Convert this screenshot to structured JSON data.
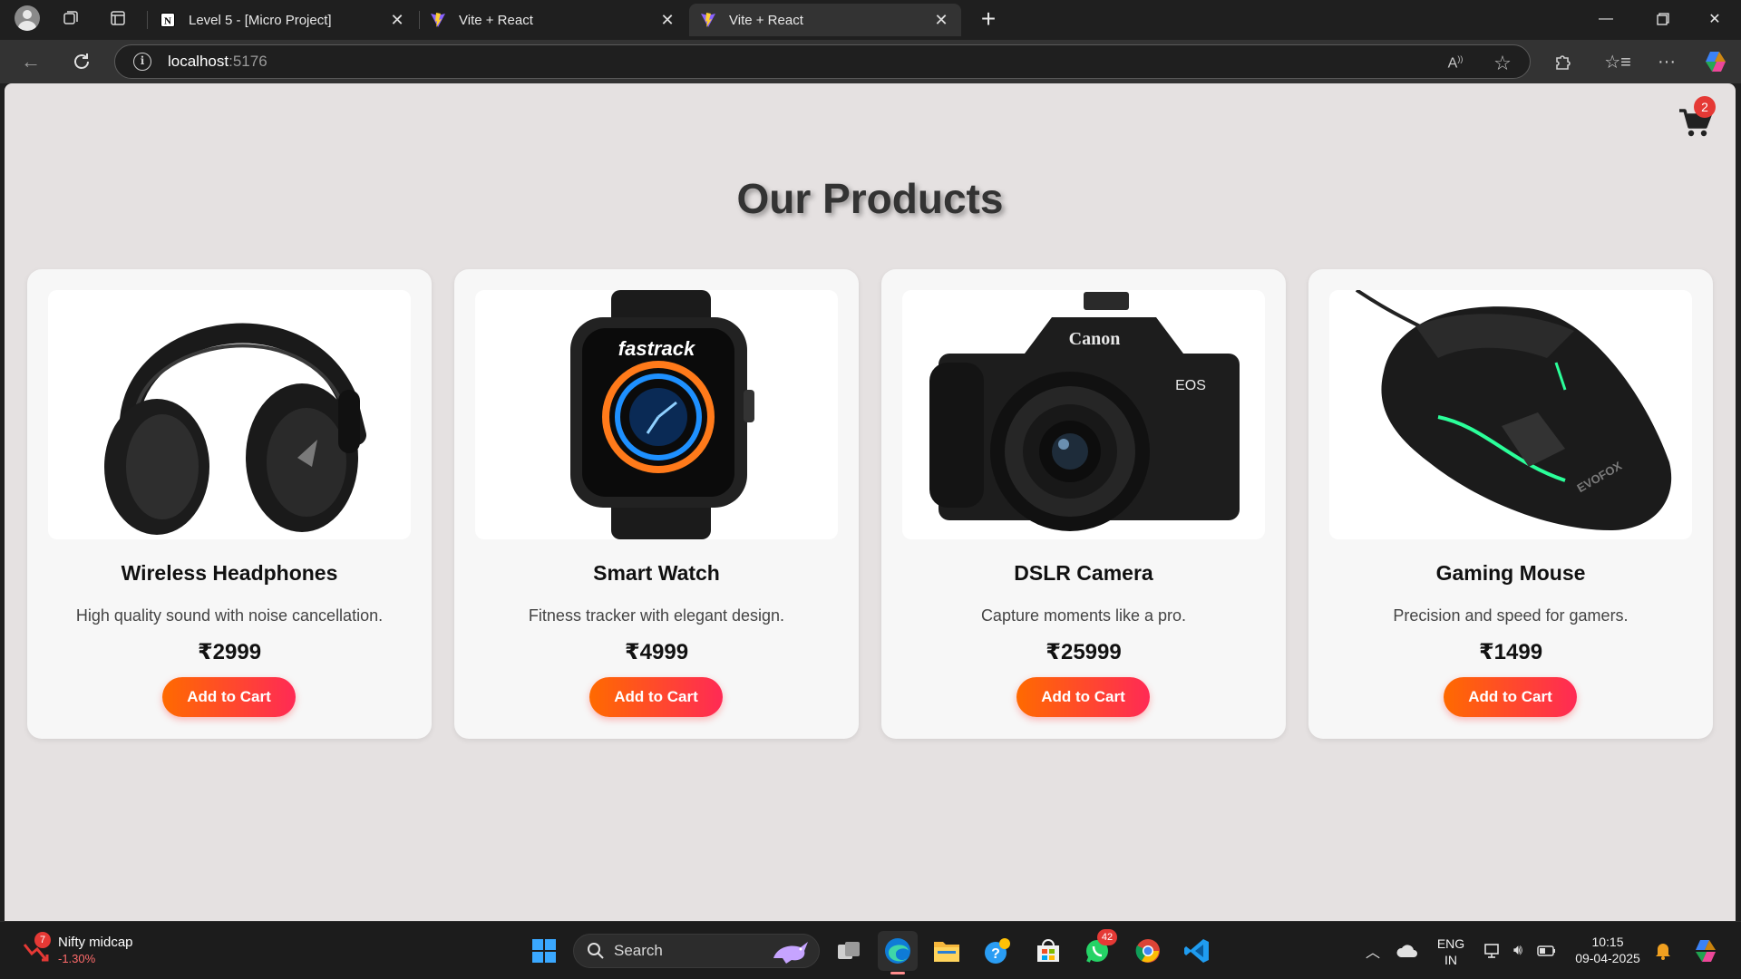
{
  "browser": {
    "tabs": [
      {
        "title": "Level 5 - [Micro Project]",
        "active": false,
        "favicon": "notion-icon"
      },
      {
        "title": "Vite + React",
        "active": false,
        "favicon": "vite-icon"
      },
      {
        "title": "Vite + React",
        "active": true,
        "favicon": "vite-icon"
      }
    ],
    "address": {
      "host": "localhost",
      "port": ":5176"
    }
  },
  "page": {
    "title": "Our Products",
    "cart_count": "2",
    "products": [
      {
        "name": "Wireless Headphones",
        "description": "High quality sound with noise cancellation.",
        "price": "₹2999",
        "button": "Add to Cart",
        "image": "headphones-image"
      },
      {
        "name": "Smart Watch",
        "description": "Fitness tracker with elegant design.",
        "price": "₹4999",
        "button": "Add to Cart",
        "image": "smartwatch-image",
        "brand_mark": "fastrack"
      },
      {
        "name": "DSLR Camera",
        "description": "Capture moments like a pro.",
        "price": "₹25999",
        "button": "Add to Cart",
        "image": "camera-image",
        "brand_mark": "Canon",
        "model_mark": "EOS"
      },
      {
        "name": "Gaming Mouse",
        "description": "Precision and speed for gamers.",
        "price": "₹1499",
        "button": "Add to Cart",
        "image": "gaming-mouse-image",
        "brand_mark": "EVOFOX"
      }
    ]
  },
  "taskbar": {
    "widget": {
      "badge": "7",
      "title": "Nifty midcap",
      "change": "-1.30%"
    },
    "search_label": "Search",
    "whatsapp_badge": "42",
    "language": {
      "line1": "ENG",
      "line2": "IN"
    },
    "clock": {
      "time": "10:15",
      "date": "09-04-2025"
    }
  },
  "colors": {
    "page_bg": "#e5e1e1",
    "card_bg": "#f7f7f7",
    "button_gradient_start": "#ff6a00",
    "button_gradient_end": "#ff2a55",
    "badge": "#e53935"
  }
}
